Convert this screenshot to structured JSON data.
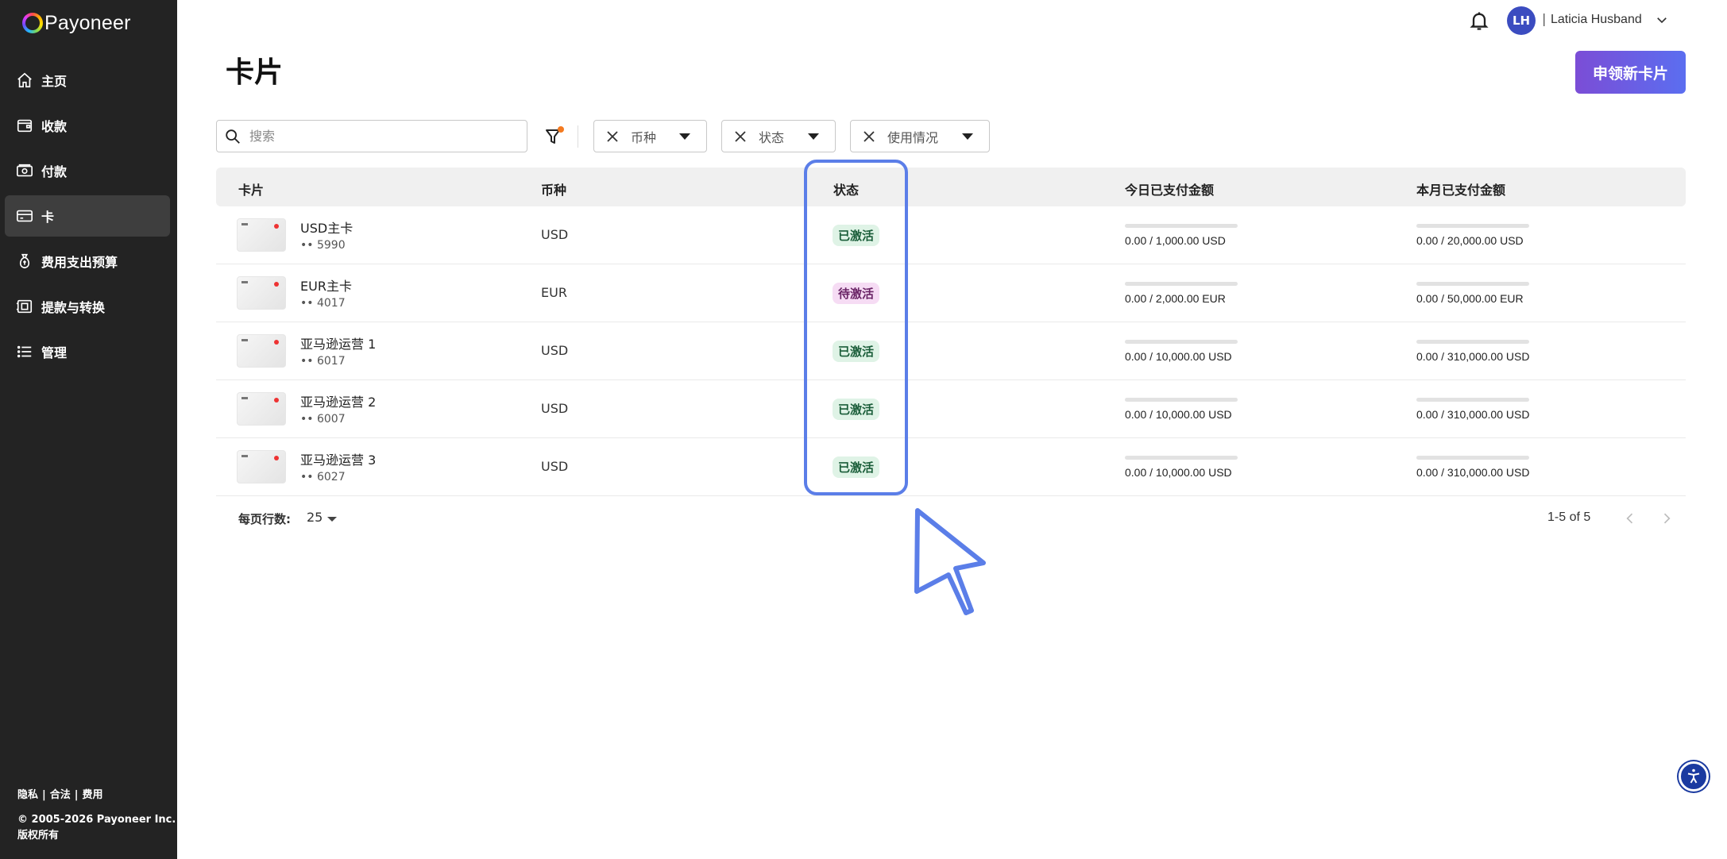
{
  "brand": {
    "name": "Payoneer"
  },
  "sidebar": {
    "items": [
      {
        "label": "主页",
        "icon": "home-icon"
      },
      {
        "label": "收款",
        "icon": "wallet-icon"
      },
      {
        "label": "付款",
        "icon": "payment-icon"
      },
      {
        "label": "卡",
        "icon": "card-icon",
        "active": true
      },
      {
        "label": "费用支出预算",
        "icon": "money-bag-icon"
      },
      {
        "label": "提款与转换",
        "icon": "withdraw-icon"
      },
      {
        "label": "管理",
        "icon": "list-icon"
      }
    ],
    "footer": {
      "links": [
        "隐私",
        "合法",
        "费用"
      ],
      "separator": "|",
      "copyright": "© 2005-2026 Payoneer Inc.",
      "rights": "版权所有"
    }
  },
  "header": {
    "avatar_initials": "LH",
    "separator": "|",
    "user_name": "Laticia Husband"
  },
  "page": {
    "title": "卡片",
    "apply_button": "申领新卡片"
  },
  "filters": {
    "search_placeholder": "搜索",
    "chips": [
      "币种",
      "状态",
      "使用情况"
    ]
  },
  "table": {
    "columns": [
      "卡片",
      "币种",
      "状态",
      "今日已支付金额",
      "本月已支付金额"
    ],
    "rows": [
      {
        "name": "USD主卡",
        "number": "•• 5990",
        "currency": "USD",
        "status": "已激活",
        "status_type": "active",
        "today": "0.00 / 1,000.00 USD",
        "month": "0.00 / 20,000.00 USD",
        "today_fraction": 0,
        "month_fraction": 0
      },
      {
        "name": "EUR主卡",
        "number": "•• 4017",
        "currency": "EUR",
        "status": "待激活",
        "status_type": "pending",
        "today": "0.00 / 2,000.00 EUR",
        "month": "0.00 / 50,000.00 EUR",
        "today_fraction": 0,
        "month_fraction": 0
      },
      {
        "name": "亚马逊运营 1",
        "number": "•• 6017",
        "currency": "USD",
        "status": "已激活",
        "status_type": "active",
        "today": "0.00 / 10,000.00 USD",
        "month": "0.00 / 310,000.00 USD",
        "today_fraction": 0,
        "month_fraction": 0
      },
      {
        "name": "亚马逊运营 2",
        "number": "•• 6007",
        "currency": "USD",
        "status": "已激活",
        "status_type": "active",
        "today": "0.00 / 10,000.00 USD",
        "month": "0.00 / 310,000.00 USD",
        "today_fraction": 0,
        "month_fraction": 0
      },
      {
        "name": "亚马逊运营 3",
        "number": "•• 6027",
        "currency": "USD",
        "status": "已激活",
        "status_type": "active",
        "today": "0.00 / 10,000.00 USD",
        "month": "0.00 / 310,000.00 USD",
        "today_fraction": 0,
        "month_fraction": 0
      }
    ]
  },
  "pagination": {
    "rows_per_page_label": "每页行数:",
    "rows_per_page": "25",
    "info": "1-5 of 5"
  },
  "colors": {
    "sidebar_bg": "#232323",
    "accent_start": "#7b4dd6",
    "accent_end": "#5b6ef0",
    "active_badge_bg": "#dff3e6",
    "pending_badge_bg": "#f6dcf4",
    "annotation": "#5b7ee8"
  }
}
